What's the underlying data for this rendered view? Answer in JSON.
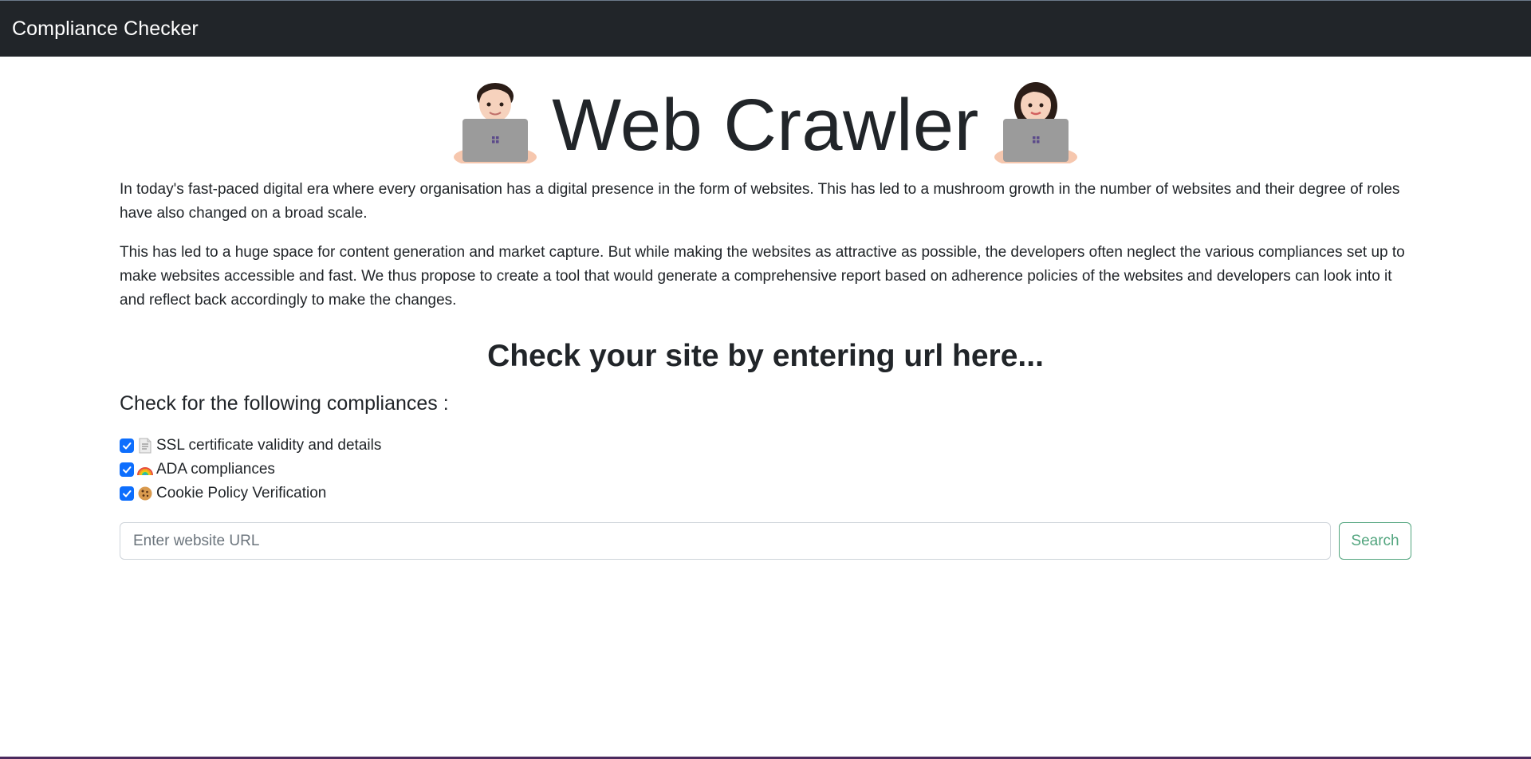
{
  "navbar": {
    "brand": "Compliance Checker"
  },
  "hero": {
    "title": "Web Crawler",
    "left_icon": "man-technologist-icon",
    "right_icon": "woman-technologist-icon"
  },
  "intro": {
    "paragraph_1": "In today's fast-paced digital era where every organisation has a digital presence in the form of websites. This has led to a mushroom growth in the number of websites and their degree of roles have also changed on a broad scale.",
    "paragraph_2": "This has led to a huge space for content generation and market capture. But while making the websites as attractive as possible, the developers often neglect the various compliances set up to make websites accessible and fast. We thus propose to create a tool that would generate a comprehensive report based on adherence policies of the websites and developers can look into it and reflect back accordingly to make the changes."
  },
  "check": {
    "heading": "Check your site by entering url here...",
    "lead": "Check for the following compliances :",
    "options": [
      {
        "label": "SSL certificate validity and details",
        "icon": "page-icon",
        "checked": true
      },
      {
        "label": "ADA compliances",
        "icon": "rainbow-icon",
        "checked": true
      },
      {
        "label": "Cookie Policy Verification",
        "icon": "cookie-icon",
        "checked": true
      }
    ]
  },
  "search": {
    "placeholder": "Enter website URL",
    "value": "",
    "button_label": "Search"
  },
  "colors": {
    "navbar_bg": "#212529",
    "checkbox_accent": "#0d6efd",
    "search_button": "#198754"
  }
}
